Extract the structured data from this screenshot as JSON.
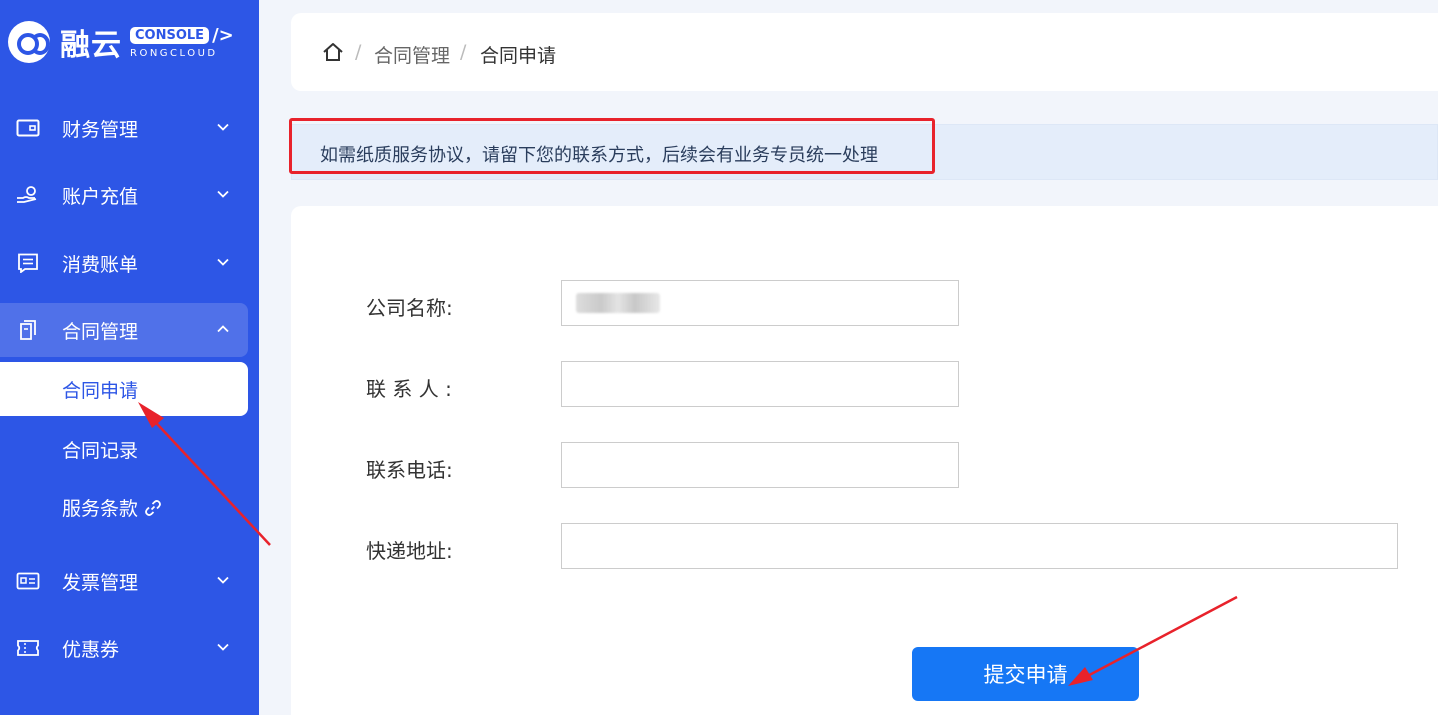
{
  "logo": {
    "brand": "融云",
    "console": "CONSOLE",
    "slash": "/>",
    "sub": "RONGCLOUD"
  },
  "sidebar": {
    "items": [
      {
        "label": "财务管理",
        "icon": "wallet-icon"
      },
      {
        "label": "账户充值",
        "icon": "hand-coin-icon"
      },
      {
        "label": "消费账单",
        "icon": "bill-icon"
      },
      {
        "label": "合同管理",
        "icon": "contract-icon",
        "expanded": true,
        "children": [
          {
            "label": "合同申请",
            "active": true
          },
          {
            "label": "合同记录"
          },
          {
            "label": "服务条款"
          }
        ]
      },
      {
        "label": "发票管理",
        "icon": "invoice-icon"
      },
      {
        "label": "优惠券",
        "icon": "coupon-icon"
      }
    ]
  },
  "breadcrumb": {
    "parent": "合同管理",
    "current": "合同申请",
    "separator": "/"
  },
  "notice": "如需纸质服务协议，请留下您的联系方式，后续会有业务专员统一处理",
  "form": {
    "company_label": "公司名称:",
    "contact_label": "联 系 人 :",
    "phone_label": "联系电话:",
    "address_label": "快递地址:",
    "submit_label": "提交申请"
  },
  "colors": {
    "sidebar": "#2d56e6",
    "accent": "#1677f5",
    "annotation": "#e8222b"
  }
}
